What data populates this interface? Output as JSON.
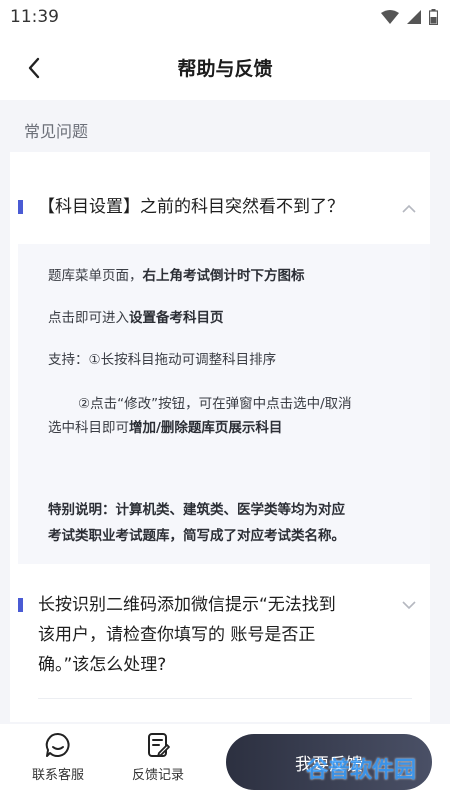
{
  "status_bar": {
    "time": "11:39"
  },
  "header": {
    "title": "帮助与反馈"
  },
  "faq": {
    "section_title": "常见问题",
    "items": [
      {
        "question": "【科目设置】之前的科目突然看不到了？",
        "expanded": true,
        "answer": {
          "line1_prefix": "题库菜单页面，",
          "line1_bold": "右上角考试倒计时下方图标",
          "line2_prefix": "点击即可进入",
          "line2_bold": "设置备考科目页",
          "line3": "支持：①长按科目拖动可调整科目排序",
          "line4": "②点击“修改”按钮，可在弹窗中点击选中/取消",
          "line5_prefix": "选中科目即可",
          "line5_bold": "增加/删除题库页展示科目",
          "note_line1": "特别说明：计算机类、建筑类、医学类等均为对应",
          "note_line2": "考试类职业考试题库，简写成了对应考试类名称。"
        }
      },
      {
        "question_line1": "长按识别二维码添加微信提示“无法找到",
        "question_line2": "该用户，请检查你填写的 账号是否正",
        "question_line3": "确。”该怎么处理?",
        "expanded": false
      }
    ]
  },
  "bottom_bar": {
    "contact_label": "联系客服",
    "records_label": "反馈记录",
    "feedback_button": "我要反馈"
  },
  "watermark": "谷普软件园",
  "colors": {
    "accent": "#4a5bd4",
    "button_dark": "#2c3040"
  }
}
